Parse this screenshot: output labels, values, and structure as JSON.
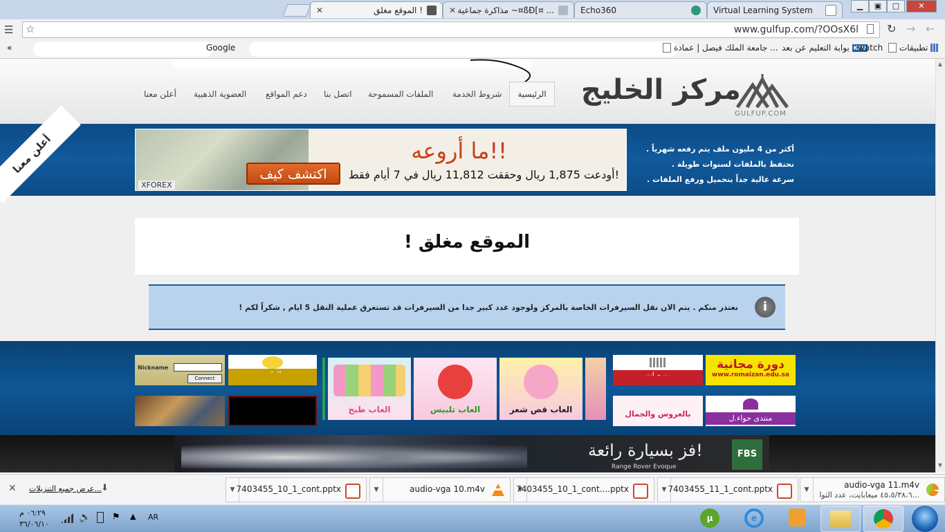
{
  "browser": {
    "tabs": [
      {
        "label": "الموقع مغلق !",
        "active": true
      },
      {
        "label": "مذاكرة جماعية ~¤ßÐ[¤ ..."
      },
      {
        "label": "Echo360"
      },
      {
        "label": "Virtual Learning System"
      }
    ],
    "url": "www.gulfup.com/?OOsX6l",
    "bookmarks": [
      {
        "label": "تطبيقات"
      },
      {
        "label": "watch"
      },
      {
        "label": "بوابة التعليم عن بعد"
      },
      {
        "label": "جامعة الملك فيصل | عمادة ..."
      },
      {
        "label": "Google"
      }
    ],
    "kfu_badge": "KFU"
  },
  "site": {
    "logo": "مركز الخليج",
    "logo_sub": "GULFUP.COM",
    "nav": [
      "الرئيسية",
      "شروط الخدمة",
      "الملفات المسموحة",
      "اتصل بنا",
      "دعم المواقع",
      "العضوية الذهبية",
      "أعلن معنا"
    ],
    "advertise_corner": "أعلن معنا",
    "features": [
      "أكثر من 4 مليون ملف يتم رفعه شهرياً .",
      "نحتفظ بالملفات لسنوات طويلة .",
      "سرعة عالية جداً بتحميل ورفع الملفات ."
    ],
    "banner": {
      "title": "ما أروعه!!",
      "subtitle": "أودعت 1,875 ريال وحققت 11,812 ريال في 7 أيام فقط!",
      "button": "اكتشف كيف",
      "brand": "XFOREX"
    },
    "closed_title": "! الموقع مغلق",
    "notice": "نعتذر منكم . يتم الان نقل السيرفرات الخاصة بالمركز ولوجود عدد كبير جدا من السيرفرات قد تستغرق عملية النقل 5 ايام , شكراً لكم !",
    "info_icon": "i",
    "ads": {
      "course": "دورة مجانية",
      "course_url": "www.romaizan.edu.sa",
      "forum": "منتدى حواء.ل",
      "stocks": "بورصات",
      "wedding": "بالعروس والجمال",
      "haircut": "العاب قص شعر",
      "dressup": "العاب تلبيس",
      "cooking": "العاب طبخ",
      "games": "العاب",
      "login_title": "Nickname",
      "connect": "Connect"
    },
    "car_ad": {
      "title": "فز بسيارة رائعة!",
      "sub": "Range Rover Evoque",
      "brand": "FBS"
    }
  },
  "downloads": {
    "items": [
      {
        "name": "audio-vga 11.m4v",
        "status": "٤٥،٥/٣٨،٦ ميغابايت، عدد الثوا..."
      },
      {
        "name": "7403455_11_1_cont.pptx"
      },
      {
        "name": "7403455_10_1_cont....pptx"
      },
      {
        "name": "audio-vga 10.m4v"
      },
      {
        "name": "7403455_10_1_cont.pptx"
      }
    ],
    "show_all": "عرض جميع التنزيلات..."
  },
  "taskbar": {
    "lang": "AR",
    "time": "٠٦:٢٩ م",
    "date": "٣٦/٠٦/١٠"
  },
  "colors": {
    "blue_band": "#115a9c",
    "notice_bg": "#b9d3ef",
    "banner_button": "#d4561c"
  }
}
